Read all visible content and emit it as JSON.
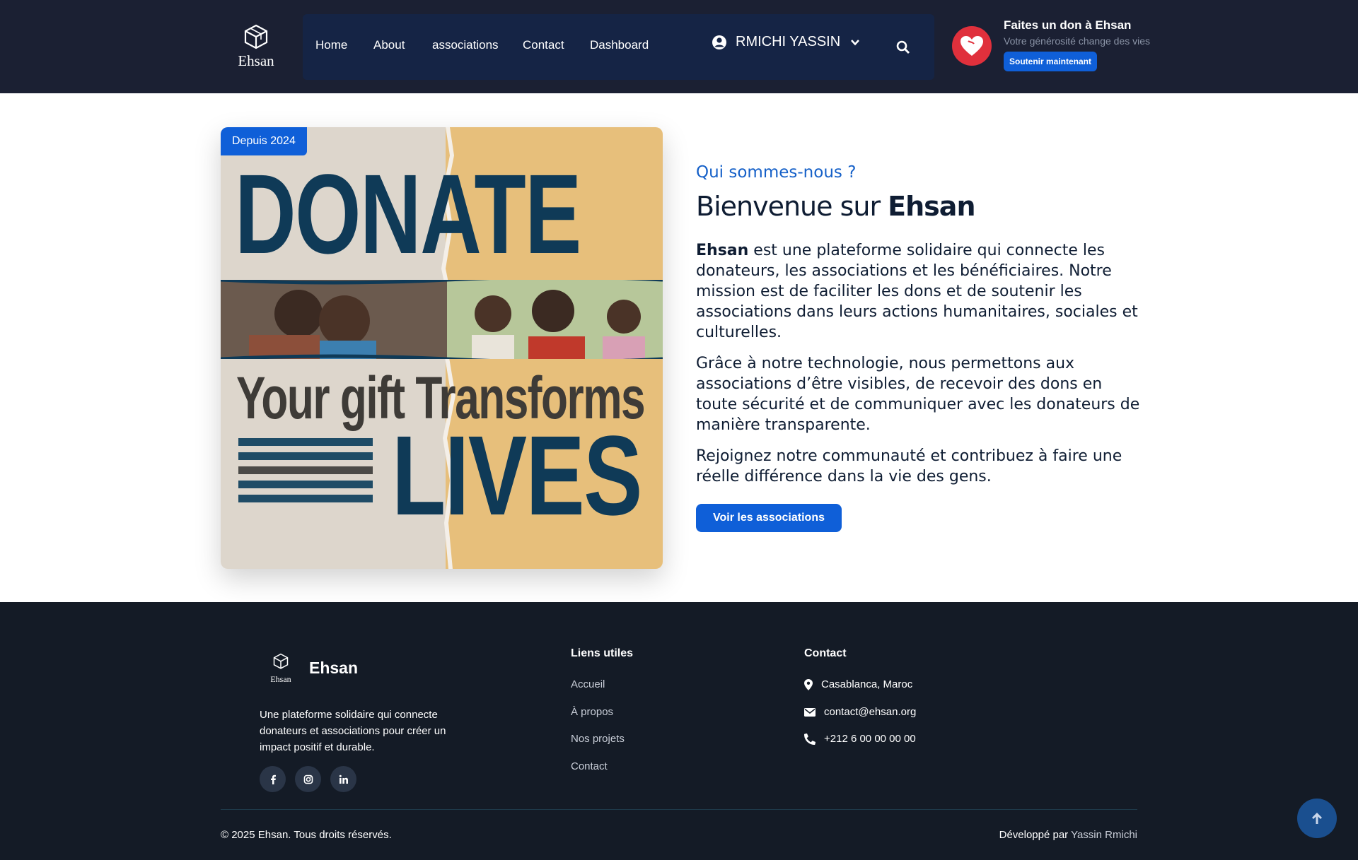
{
  "header": {
    "logo_text": "Ehsan",
    "nav": [
      "Home",
      "About",
      "associations",
      "Contact",
      "Dashboard"
    ],
    "user_name": "RMICHI YASSIN",
    "donate": {
      "title": "Faites un don à Ehsan",
      "subtitle": "Votre générosité change des vies",
      "button": "Soutenir maintenant"
    }
  },
  "hero": {
    "badge": "Depuis 2024",
    "poster": {
      "word1": "DONATE",
      "word2": "Your gift Transforms",
      "word3": "LIVES"
    },
    "kicker": "Qui sommes-nous ?",
    "title_prefix": "Bienvenue sur ",
    "title_brand": "Ehsan",
    "p1_brand": "Ehsan",
    "p1_rest": " est une plateforme solidaire qui connecte les donateurs, les associations et les bénéficiaires. Notre mission est de faciliter les dons et de soutenir les associations dans leurs actions humanitaires, sociales et culturelles.",
    "p2": "Grâce à notre technologie, nous permettons aux associations d’être visibles, de recevoir des dons en toute sécurité et de communiquer avec les donateurs de manière transparente.",
    "p3": "Rejoignez notre communauté et contribuez à faire une réelle différence dans la vie des gens.",
    "cta": "Voir les associations"
  },
  "footer": {
    "logo_text": "Ehsan",
    "brand": "Ehsan",
    "description": "Une plateforme solidaire qui connecte donateurs et associations pour créer un impact positif et durable.",
    "social": [
      "facebook-icon",
      "instagram-icon",
      "linkedin-icon"
    ],
    "links_title": "Liens utiles",
    "links": [
      "Accueil",
      "À propos",
      "Nos projets",
      "Contact"
    ],
    "contact_title": "Contact",
    "address": "Casablanca, Maroc",
    "email": "contact@ehsan.org",
    "phone": "+212 6 00 00 00 00",
    "copyright": "© 2025 Ehsan. Tous droits réservés.",
    "dev_prefix": "Développé par ",
    "dev_name": "Yassin Rmichi"
  },
  "colors": {
    "header_bg": "#1b2033",
    "nav_bg": "#152445",
    "accent": "#0f5fd8",
    "heart": "#e0303c",
    "footer_bg": "#141b26"
  }
}
